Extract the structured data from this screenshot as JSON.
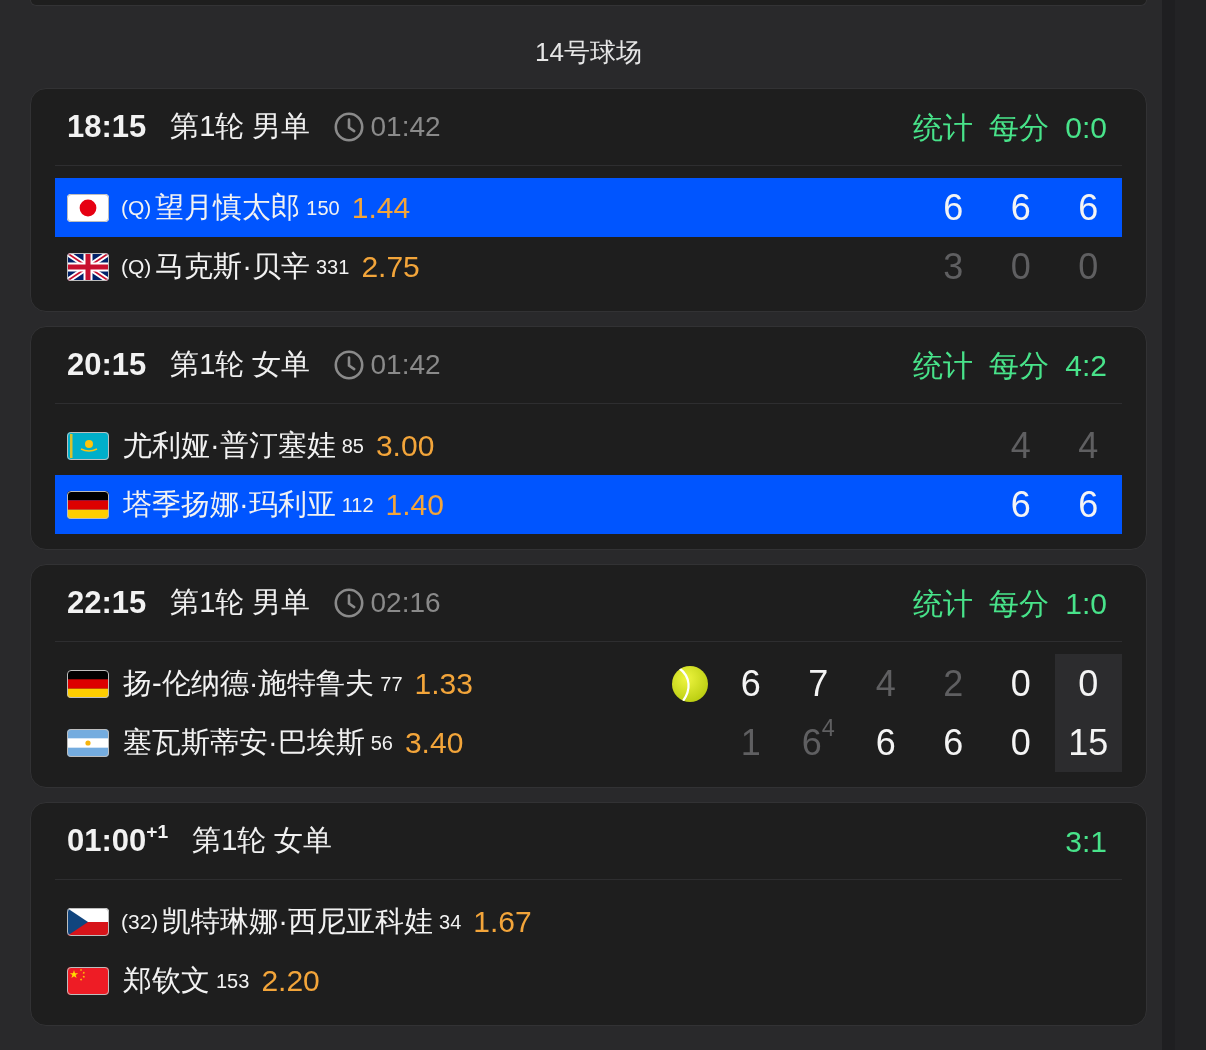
{
  "court_title": "14号球场",
  "matches": [
    {
      "time": "18:15",
      "round": "第1轮 男单",
      "duration": "01:42",
      "links": [
        "统计",
        "每分"
      ],
      "ratio": "0:0",
      "players": [
        {
          "flag": {
            "kind": "jp"
          },
          "seed": "(Q)",
          "name": "望月慎太郎",
          "rank": "150",
          "odds": "1.44",
          "winner": true,
          "serving": false,
          "sets": [
            {
              "score": "6",
              "lost": false
            },
            {
              "score": "6",
              "lost": false
            },
            {
              "score": "6",
              "lost": false
            }
          ]
        },
        {
          "flag": {
            "kind": "gb"
          },
          "seed": "(Q)",
          "name": "马克斯·贝辛",
          "rank": "331",
          "odds": "2.75",
          "winner": false,
          "serving": false,
          "sets": [
            {
              "score": "3",
              "lost": true
            },
            {
              "score": "0",
              "lost": true
            },
            {
              "score": "0",
              "lost": true
            }
          ]
        }
      ]
    },
    {
      "time": "20:15",
      "round": "第1轮 女单",
      "duration": "01:42",
      "links": [
        "统计",
        "每分"
      ],
      "ratio": "4:2",
      "players": [
        {
          "flag": {
            "kind": "kz"
          },
          "name": "尤利娅·普汀塞娃",
          "rank": "85",
          "odds": "3.00",
          "winner": false,
          "serving": false,
          "sets": [
            {
              "score": "4",
              "lost": true
            },
            {
              "score": "4",
              "lost": true
            }
          ]
        },
        {
          "flag": {
            "kind": "de"
          },
          "name": "塔季扬娜·玛利亚",
          "rank": "112",
          "odds": "1.40",
          "winner": true,
          "serving": false,
          "sets": [
            {
              "score": "6",
              "lost": false
            },
            {
              "score": "6",
              "lost": false
            }
          ]
        }
      ]
    },
    {
      "time": "22:15",
      "round": "第1轮 男单",
      "duration": "02:16",
      "links": [
        "统计",
        "每分"
      ],
      "ratio": "1:0",
      "players": [
        {
          "flag": {
            "kind": "de"
          },
          "name": "扬-伦纳德·施特鲁夫",
          "rank": "77",
          "odds": "1.33",
          "winner": false,
          "serving": true,
          "sets": [
            {
              "score": "6",
              "lost": false
            },
            {
              "score": "7",
              "lost": false
            },
            {
              "score": "4",
              "lost": true
            },
            {
              "score": "2",
              "lost": true
            },
            {
              "score": "0",
              "lost": false
            }
          ],
          "point": "0"
        },
        {
          "flag": {
            "kind": "ar"
          },
          "name": "塞瓦斯蒂安·巴埃斯",
          "rank": "56",
          "odds": "3.40",
          "winner": false,
          "serving": false,
          "sets": [
            {
              "score": "1",
              "lost": true
            },
            {
              "score": "6$^{4}$",
              "lost": true
            },
            {
              "score": "6",
              "lost": false
            },
            {
              "score": "6",
              "lost": false
            },
            {
              "score": "0",
              "lost": false
            }
          ],
          "point": "15"
        }
      ]
    },
    {
      "time": "01:00$^{+1}$",
      "round": "第1轮 女单",
      "ratio": "3:1",
      "players": [
        {
          "flag": {
            "kind": "cz"
          },
          "seed": "(32)",
          "name": "凯特琳娜·西尼亚科娃",
          "rank": "34",
          "odds": "1.67",
          "winner": false,
          "serving": false
        },
        {
          "flag": {
            "kind": "cn"
          },
          "name": "郑钦文",
          "rank": "153",
          "odds": "2.20",
          "winner": false,
          "serving": false
        }
      ]
    }
  ]
}
